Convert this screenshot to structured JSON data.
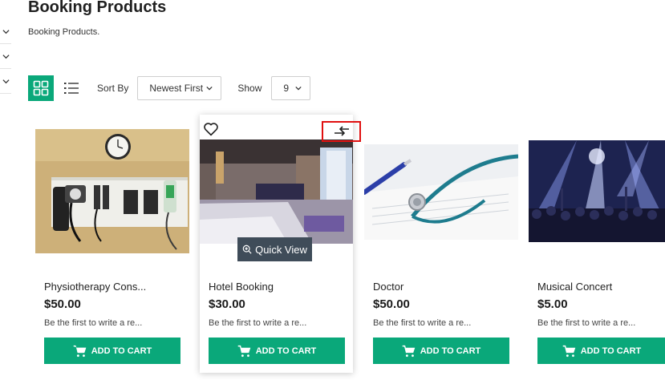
{
  "page": {
    "title": "Booking Products",
    "description": "Booking Products."
  },
  "toolbar": {
    "sort_label": "Sort By",
    "sort_value": "Newest First",
    "show_label": "Show",
    "show_value": "9"
  },
  "colors": {
    "accent": "#0aa87a",
    "quick_view_bg": "#3f4c59",
    "highlight_border": "#e01010"
  },
  "products": [
    {
      "name": "Physiotherapy Cons...",
      "price": "$50.00",
      "review": "Be the first to write a re...",
      "cart_label": "ADD TO CART"
    },
    {
      "name": "Hotel Booking",
      "price": "$30.00",
      "review": "Be the first to write a re...",
      "cart_label": "ADD TO CART",
      "quick_view_label": "Quick View"
    },
    {
      "name": "Doctor",
      "price": "$50.00",
      "review": "Be the first to write a re...",
      "cart_label": "ADD TO CART"
    },
    {
      "name": "Musical Concert",
      "price": "$5.00",
      "review": "Be the first to write a re...",
      "cart_label": "ADD TO CART"
    }
  ]
}
